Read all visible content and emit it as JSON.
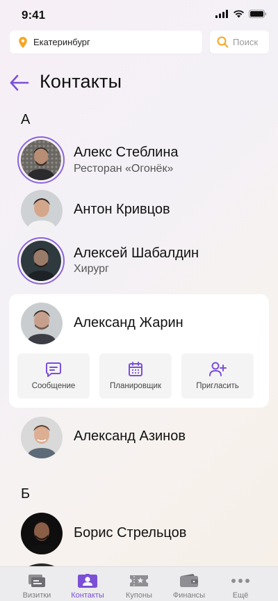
{
  "status_bar": {
    "time": "9:41"
  },
  "header": {
    "location": "Екатеринбург",
    "search_placeholder": "Поиск",
    "title": "Контакты"
  },
  "sections": [
    {
      "letter": "А"
    },
    {
      "letter": "Б"
    }
  ],
  "contacts": [
    {
      "name": "Алекс Стеблина",
      "subtitle": "Ресторан «Огонёк»",
      "ring": true
    },
    {
      "name": "Антон Кривцов",
      "subtitle": "",
      "ring": false
    },
    {
      "name": "Алексей Шабалдин",
      "subtitle": "Хирург",
      "ring": true
    },
    {
      "name": "Александ Жарин",
      "subtitle": "",
      "ring": false,
      "expanded": true
    },
    {
      "name": "Александ Азинов",
      "subtitle": "",
      "ring": false
    },
    {
      "name": "Борис Стрельцов",
      "subtitle": "",
      "ring": false
    }
  ],
  "card_actions": [
    {
      "label": "Сообщение",
      "icon": "message-icon"
    },
    {
      "label": "Планировщик",
      "icon": "calendar-icon"
    },
    {
      "label": "Пригласить",
      "icon": "add-user-icon"
    }
  ],
  "tabbar": {
    "tabs": [
      {
        "label": "Визитки",
        "icon": "cards-icon",
        "active": false
      },
      {
        "label": "Контакты",
        "icon": "contacts-icon",
        "active": true
      },
      {
        "label": "Купоны",
        "icon": "coupon-icon",
        "active": false
      },
      {
        "label": "Финансы",
        "icon": "wallet-icon",
        "active": false
      },
      {
        "label": "Ещё",
        "icon": "more-icon",
        "active": false
      }
    ]
  },
  "colors": {
    "accent": "#7b4fd6",
    "ring": "#8a63d9",
    "pin": "#f5a623",
    "search": "#f5a623"
  }
}
